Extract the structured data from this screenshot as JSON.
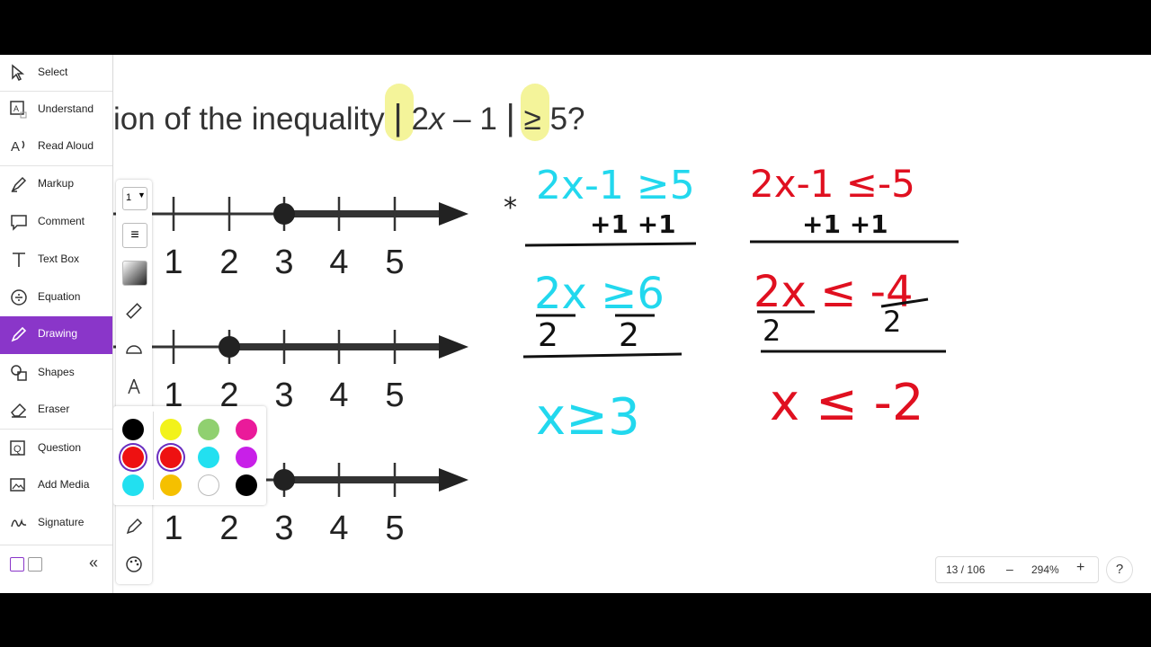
{
  "sidebar": {
    "tools": [
      {
        "label": "Select",
        "icon": "cursor-icon"
      },
      {
        "label": "Understand",
        "icon": "understand-icon"
      },
      {
        "label": "Read Aloud",
        "icon": "read-aloud-icon"
      },
      {
        "label": "Markup",
        "icon": "highlighter-icon"
      },
      {
        "label": "Comment",
        "icon": "comment-icon"
      },
      {
        "label": "Text Box",
        "icon": "text-icon"
      },
      {
        "label": "Equation",
        "icon": "equation-icon"
      },
      {
        "label": "Drawing",
        "icon": "pen-icon"
      },
      {
        "label": "Shapes",
        "icon": "shapes-icon"
      },
      {
        "label": "Eraser",
        "icon": "eraser-icon"
      },
      {
        "label": "Question",
        "icon": "question-icon"
      },
      {
        "label": "Add Media",
        "icon": "media-icon"
      },
      {
        "label": "Signature",
        "icon": "signature-icon"
      }
    ],
    "active_tool": "Drawing",
    "collapse_icon": "double-chevron-left-icon"
  },
  "question": {
    "text_before": "ion of the inequality",
    "abs_open": "|",
    "expr_a": "2",
    "expr_var": "x",
    "expr_b": " – 1 ",
    "abs_close": "|",
    "expr_c": " ≥ 5?"
  },
  "number_lines": [
    {
      "labels": [
        "1",
        "2",
        "3",
        "4",
        "5"
      ],
      "closed_point": "3"
    },
    {
      "labels": [
        "1",
        "2",
        "3",
        "4",
        "5"
      ],
      "closed_point": "2"
    },
    {
      "labels": [
        "1",
        "2",
        "3",
        "4",
        "5"
      ],
      "closed_point": "3"
    }
  ],
  "palette": {
    "stroke_width": "1",
    "colors_left": [
      "#000000",
      "#ee1111",
      "#22e0f0"
    ],
    "colors_grid": [
      "#f2f21a",
      "#90d070",
      "#ea1a9a",
      "#ee1111",
      "#22e0f0",
      "#c820e8",
      "#f5c000",
      "#ffffff",
      "#000000"
    ],
    "selected_color": "#ee1111"
  },
  "handwriting": {
    "cyan": {
      "line1": "2x-1 ≥5",
      "line2": "+1   +1",
      "line3": "2x ≥6",
      "line4_a": "2",
      "line4_b": "2",
      "result": "x≥3"
    },
    "red": {
      "line1": "2x-1 ≤-5",
      "line2": "+1   +1",
      "line3": "2x ≤ -4",
      "line4_a": "2",
      "line4_b": "2",
      "result": "x ≤ -2"
    },
    "asterisk": "*"
  },
  "pager": {
    "page": "13 / 106",
    "minus": "–",
    "zoom": "294%",
    "plus": "+",
    "help": "?"
  },
  "colors": {
    "accent": "#8a36c9",
    "cyan_ink": "#22d8ee",
    "red_ink": "#e01020"
  }
}
